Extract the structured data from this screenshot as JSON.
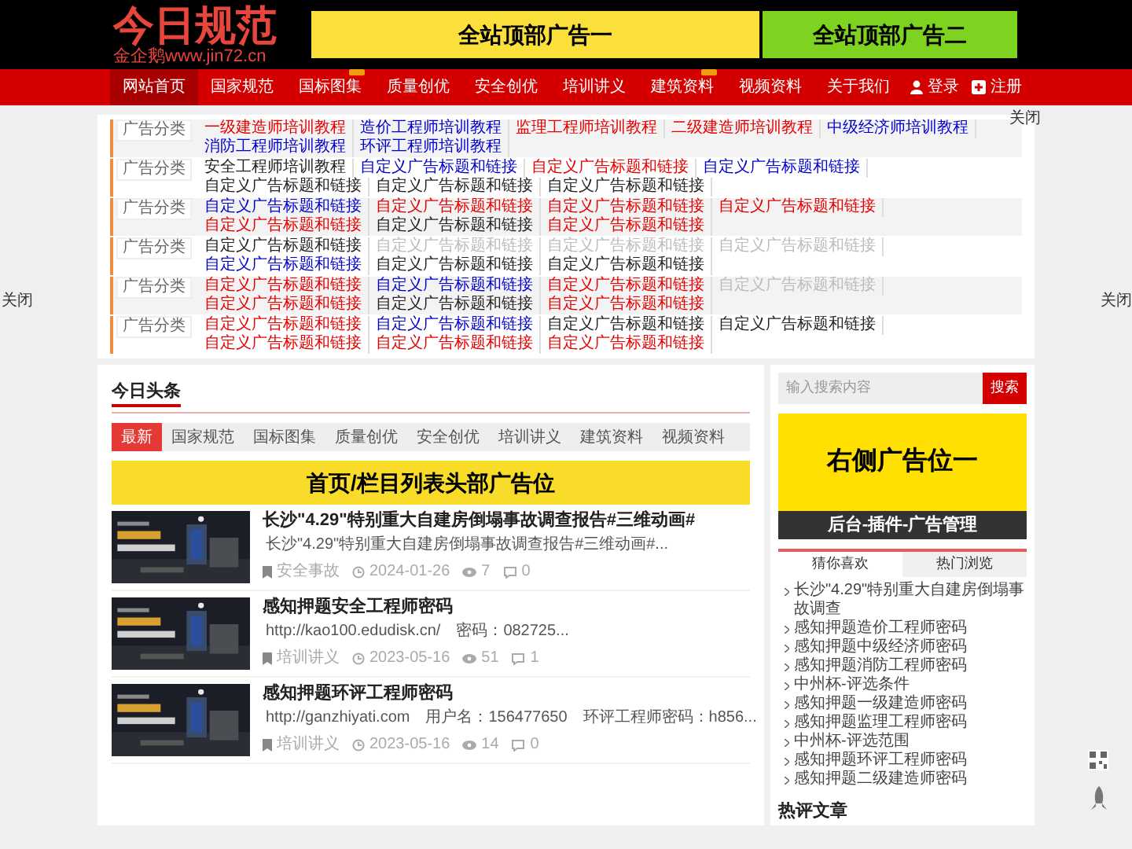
{
  "header": {
    "logo_title": "今日规范",
    "logo_subtitle": "金企鹅www.jin72.cn",
    "banners": [
      {
        "text": "全站顶部广告一",
        "color": "#fbe03c"
      },
      {
        "text": "全站顶部广告二",
        "color": "#7ed321"
      }
    ]
  },
  "nav": {
    "items": [
      {
        "label": "网站首页",
        "selected": true,
        "badge": false
      },
      {
        "label": "国家规范",
        "selected": false,
        "badge": false
      },
      {
        "label": "国标图集",
        "selected": false,
        "badge": true
      },
      {
        "label": "质量创优",
        "selected": false,
        "badge": false
      },
      {
        "label": "安全创优",
        "selected": false,
        "badge": false
      },
      {
        "label": "培训讲义",
        "selected": false,
        "badge": false
      },
      {
        "label": "建筑资料",
        "selected": false,
        "badge": true
      },
      {
        "label": "视频资料",
        "selected": false,
        "badge": false
      },
      {
        "label": "关于我们",
        "selected": false,
        "badge": false
      }
    ],
    "login": "登录",
    "register": "注册"
  },
  "ad_links": {
    "close": "关闭",
    "rows": [
      {
        "label": "广告分类",
        "links": [
          {
            "text": "一级建造师培训教程",
            "color": "#e60000"
          },
          {
            "text": "造价工程师培训教程",
            "color": "#0000cc"
          },
          {
            "text": "监理工程师培训教程",
            "color": "#e60000"
          },
          {
            "text": "二级建造师培训教程",
            "color": "#e60000"
          },
          {
            "text": "中级经济师培训教程",
            "color": "#0000cc"
          },
          {
            "text": "消防工程师培训教程",
            "color": "#0000cc"
          },
          {
            "text": "环评工程师培训教程",
            "color": "#0000cc"
          }
        ]
      },
      {
        "label": "广告分类",
        "links": [
          {
            "text": "安全工程师培训教程",
            "color": "#222222"
          },
          {
            "text": "自定义广告标题和链接",
            "color": "#0000cc"
          },
          {
            "text": "自定义广告标题和链接",
            "color": "#e60000"
          },
          {
            "text": "自定义广告标题和链接",
            "color": "#0000cc"
          },
          {
            "text": "自定义广告标题和链接",
            "color": "#222222"
          },
          {
            "text": "自定义广告标题和链接",
            "color": "#222222"
          },
          {
            "text": "自定义广告标题和链接",
            "color": "#222222"
          }
        ]
      },
      {
        "label": "广告分类",
        "links": [
          {
            "text": "自定义广告标题和链接",
            "color": "#0000cc"
          },
          {
            "text": "自定义广告标题和链接",
            "color": "#e60000"
          },
          {
            "text": "自定义广告标题和链接",
            "color": "#e60000"
          },
          {
            "text": "自定义广告标题和链接",
            "color": "#e60000"
          },
          {
            "text": "自定义广告标题和链接",
            "color": "#e60000"
          },
          {
            "text": "自定义广告标题和链接",
            "color": "#222222"
          },
          {
            "text": "自定义广告标题和链接",
            "color": "#e60000"
          }
        ]
      },
      {
        "label": "广告分类",
        "links": [
          {
            "text": "自定义广告标题和链接",
            "color": "#222222"
          },
          {
            "text": "自定义广告标题和链接",
            "color": "#bbbbbb"
          },
          {
            "text": "自定义广告标题和链接",
            "color": "#bbbbbb"
          },
          {
            "text": "自定义广告标题和链接",
            "color": "#bbbbbb"
          },
          {
            "text": "自定义广告标题和链接",
            "color": "#0000cc"
          },
          {
            "text": "自定义广告标题和链接",
            "color": "#222222"
          },
          {
            "text": "自定义广告标题和链接",
            "color": "#222222"
          }
        ]
      },
      {
        "label": "广告分类",
        "links": [
          {
            "text": "自定义广告标题和链接",
            "color": "#e60000"
          },
          {
            "text": "自定义广告标题和链接",
            "color": "#0000cc"
          },
          {
            "text": "自定义广告标题和链接",
            "color": "#e60000"
          },
          {
            "text": "自定义广告标题和链接",
            "color": "#bbbbbb"
          },
          {
            "text": "自定义广告标题和链接",
            "color": "#e60000"
          },
          {
            "text": "自定义广告标题和链接",
            "color": "#222222"
          },
          {
            "text": "自定义广告标题和链接",
            "color": "#e60000"
          }
        ]
      },
      {
        "label": "广告分类",
        "links": [
          {
            "text": "自定义广告标题和链接",
            "color": "#e60000"
          },
          {
            "text": "自定义广告标题和链接",
            "color": "#0000cc"
          },
          {
            "text": "自定义广告标题和链接",
            "color": "#222222"
          },
          {
            "text": "自定义广告标题和链接",
            "color": "#222222"
          },
          {
            "text": "自定义广告标题和链接",
            "color": "#e60000"
          },
          {
            "text": "自定义广告标题和链接",
            "color": "#e60000"
          },
          {
            "text": "自定义广告标题和链接",
            "color": "#e60000"
          }
        ]
      }
    ]
  },
  "side_close": {
    "left": "关闭",
    "right": "关闭"
  },
  "main": {
    "title": "今日头条",
    "tabs": [
      {
        "label": "最新",
        "selected": true
      },
      {
        "label": "国家规范",
        "selected": false
      },
      {
        "label": "国标图集",
        "selected": false
      },
      {
        "label": "质量创优",
        "selected": false
      },
      {
        "label": "安全创优",
        "selected": false
      },
      {
        "label": "培训讲义",
        "selected": false
      },
      {
        "label": "建筑资料",
        "selected": false
      },
      {
        "label": "视频资料",
        "selected": false
      }
    ],
    "banner": "首页/栏目列表头部广告位",
    "articles": [
      {
        "title": "长沙\"4.29\"特别重大自建房倒塌事故调查报告#三维动画#",
        "excerpt": [
          "长沙\"4.29\"特别重大自建房倒塌事故调查报告#三维动画#..."
        ],
        "category": "安全事故",
        "date": "2024-01-26",
        "views": "7",
        "comments": "0"
      },
      {
        "title": "感知押题安全工程师密码",
        "excerpt": [
          "http://kao100.edudisk.cn/",
          "密码：082725..."
        ],
        "category": "培训讲义",
        "date": "2023-05-16",
        "views": "51",
        "comments": "1"
      },
      {
        "title": "感知押题环评工程师密码",
        "excerpt": [
          "http://ganzhiyati.com",
          "用户名：156477650",
          "环评工程师密码：h856..."
        ],
        "category": "培训讲义",
        "date": "2023-05-16",
        "views": "14",
        "comments": "0"
      }
    ]
  },
  "sidebar": {
    "search": {
      "placeholder": "输入搜索内容",
      "button": "搜索"
    },
    "ad": {
      "title": "右侧广告位一",
      "footer": "后台-插件-广告管理"
    },
    "tabs": [
      {
        "label": "猜你喜欢",
        "selected": true
      },
      {
        "label": "热门浏览",
        "selected": false
      }
    ],
    "list": [
      "长沙\"4.29\"特别重大自建房倒塌事故调查",
      "感知押题造价工程师密码",
      "感知押题中级经济师密码",
      "感知押题消防工程师密码",
      "中州杯-评选条件",
      "感知押题一级建造师密码",
      "感知押题监理工程师密码",
      "中州杯-评选范围",
      "感知押题环评工程师密码",
      "感知押题二级建造师密码"
    ],
    "next_heading": "热评文章"
  }
}
